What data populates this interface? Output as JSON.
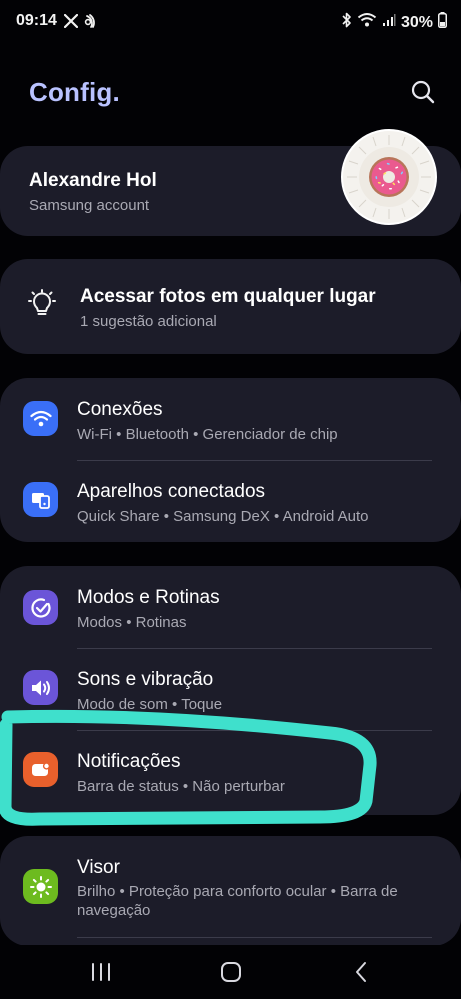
{
  "status_bar": {
    "time": "09:14",
    "battery": "30%",
    "icons": [
      "x-icon",
      "nfc-icon",
      "bluetooth-icon",
      "wifi-icon",
      "signal-icon",
      "battery-icon"
    ]
  },
  "header": {
    "title": "Config.",
    "search_icon": "search-icon"
  },
  "profile": {
    "name": "Alexandre Hol",
    "subtitle": "Samsung account",
    "avatar": "donut-avatar"
  },
  "suggestion": {
    "title": "Acessar fotos em qualquer lugar",
    "subtitle": "1 sugestão adicional",
    "icon": "lightbulb-icon"
  },
  "groups": [
    {
      "items": [
        {
          "title": "Conexões",
          "subtitle": "Wi-Fi  •  Bluetooth  •  Gerenciador de chip",
          "icon": "wifi-icon",
          "color": "#3a6ff7"
        },
        {
          "title": "Aparelhos conectados",
          "subtitle": "Quick Share  •  Samsung DeX  •  Android Auto",
          "icon": "devices-icon",
          "color": "#3a6ff7"
        }
      ]
    },
    {
      "items": [
        {
          "title": "Modos e Rotinas",
          "subtitle": "Modos  •  Rotinas",
          "icon": "check-circle-icon",
          "color": "#6b55d8"
        },
        {
          "title": "Sons e vibração",
          "subtitle": "Modo de som  •  Toque",
          "icon": "speaker-icon",
          "color": "#6b55d8"
        },
        {
          "title": "Notificações",
          "subtitle": "Barra de status  •  Não perturbar",
          "icon": "notification-icon",
          "color": "#e8602c"
        }
      ]
    },
    {
      "items": [
        {
          "title": "Visor",
          "subtitle": "Brilho  •  Proteção para conforto ocular  •  Barra de navegação",
          "icon": "brightness-icon",
          "color": "#6dbb1f"
        }
      ]
    }
  ],
  "nav": {
    "recents": "recents-icon",
    "home": "home-icon",
    "back": "back-icon"
  },
  "annotation": {
    "highlight_color": "#3fe0cc"
  }
}
